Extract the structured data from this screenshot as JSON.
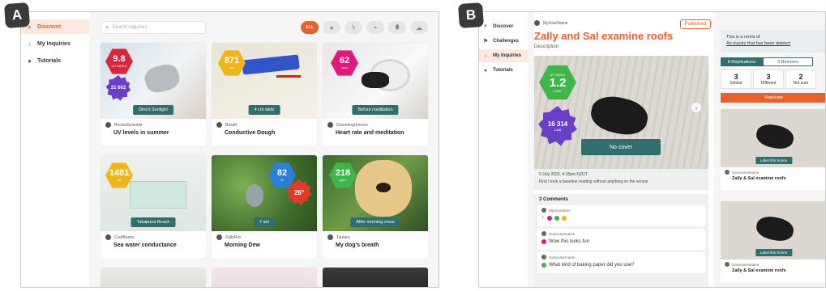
{
  "panel_a": {
    "label": "A",
    "nav": [
      {
        "label": "Discover",
        "icon": "search-icon",
        "active": true
      },
      {
        "label": "My Inquiries",
        "icon": "inquiry-icon",
        "active": false
      },
      {
        "label": "Tutorials",
        "icon": "question-icon",
        "active": false
      }
    ],
    "search_placeholder": "Search inquiries",
    "filters": [
      {
        "label": "ALL"
      },
      {
        "icon": "circle-icon"
      },
      {
        "icon": "lightning-icon"
      },
      {
        "icon": "lips-icon"
      },
      {
        "icon": "droplet-icon"
      },
      {
        "icon": "cloud-icon"
      }
    ],
    "cards": [
      {
        "badge1": "9.8",
        "badge1_sub": "UV INDEX",
        "badge2": "21 602",
        "badge2_sub": "LUX",
        "caption": "Direct Sunlight",
        "user": "RocketScientist",
        "title": "UV levels in summer"
      },
      {
        "badge1": "871",
        "badge1_sub": "cm",
        "caption": "4 cm wide",
        "user": "BossR",
        "title": "Conductive Dough"
      },
      {
        "badge1": "62",
        "badge1_sub": "bpm",
        "caption": "Before meditation",
        "user": "DreamingUnicorn",
        "title": "Heart rate and meditation"
      },
      {
        "badge1": "1481",
        "badge1_sub": "μS",
        "caption": "Takapuna Beach",
        "user": "CoolBeans",
        "title": "Sea water conductance"
      },
      {
        "badge1": "82",
        "badge1_sub": "%",
        "badge2": "26°",
        "badge2_sub": "CELSIUS",
        "caption": "7 am",
        "user": "ZallyRox",
        "title": "Morning Dew"
      },
      {
        "badge1": "218",
        "badge1_sub": "ppm",
        "caption": "After morning chow",
        "user": "Tautara",
        "title": "My dog's breath"
      }
    ]
  },
  "panel_b": {
    "label": "B",
    "nav": [
      {
        "label": "Discover",
        "icon": "search-icon",
        "active": false
      },
      {
        "label": "Challenges",
        "icon": "flag-icon",
        "active": false
      },
      {
        "label": "My Inquiries",
        "icon": "inquiry-icon",
        "active": true
      },
      {
        "label": "Tutorials",
        "icon": "question-icon",
        "active": false
      }
    ],
    "username": "MyUserName",
    "status": "Published",
    "title": "Zally and Sal examine roofs",
    "description": "Description",
    "uv_value": "1.2",
    "uv_label": "UV INDEX",
    "uv_level": "LOW",
    "lux_value": "16 314",
    "lux_label": "LUX",
    "cover_button": "No cover",
    "date": "9 July 2020, 4:18pm NZDT",
    "meta_text": "First I took a baseline reading without anything on the sensor",
    "comments_title": "3 Comments",
    "comments": [
      {
        "user": "MyUsername",
        "text": ""
      },
      {
        "user": "SomeUsername",
        "text": "Wow this looks fun"
      },
      {
        "user": "SomeUsername",
        "text": "What kind of baking paper did you use?"
      }
    ],
    "remix_text": "This is a remix of",
    "remix_link": "An inquiry that has been deleted",
    "tab_replications": "8 Replications",
    "tab_remixes": "3 Remixes",
    "reactions": [
      {
        "count": "3",
        "label": "Similar"
      },
      {
        "count": "3",
        "label": "Different"
      },
      {
        "count": "2",
        "label": "Not sure"
      }
    ],
    "replicate_button": "Replicate",
    "replications": [
      {
        "button": "Label this Scene",
        "user": "SomeUserName",
        "title": "Zally & Sal examine roofs"
      },
      {
        "button": "Label this Scene",
        "user": "SomeUserName",
        "title": "Zally & Sal examine roofs"
      }
    ]
  }
}
